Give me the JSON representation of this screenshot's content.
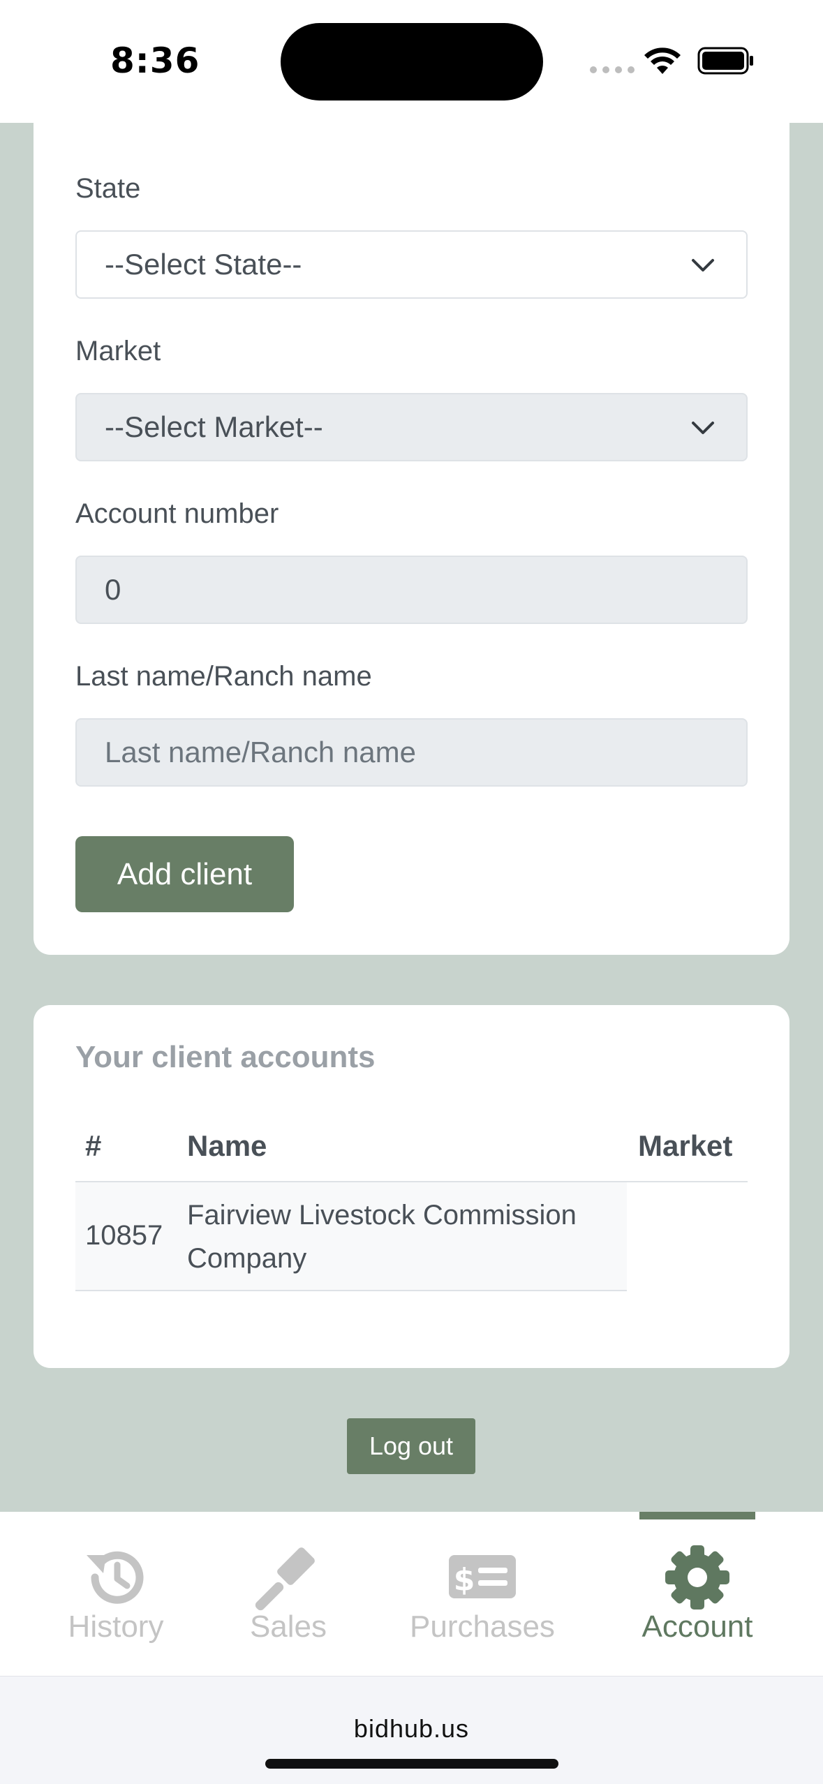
{
  "status_bar": {
    "time": "8:36"
  },
  "form": {
    "state_label": "State",
    "state_value": "--Select State--",
    "market_label": "Market",
    "market_value": "--Select Market--",
    "account_label": "Account number",
    "account_value": "0",
    "lastname_label": "Last name/Ranch name",
    "lastname_placeholder": "Last name/Ranch name",
    "add_button": "Add client"
  },
  "clients": {
    "title": "Your client accounts",
    "columns": {
      "num": "#",
      "name": "Name",
      "market": "Market"
    },
    "rows": [
      {
        "num": "10857",
        "name": "Fairview Livestock Commission Company",
        "market": ""
      }
    ]
  },
  "logout_label": "Log out",
  "tabs": [
    {
      "label": "History",
      "icon": "history-icon",
      "active": false
    },
    {
      "label": "Sales",
      "icon": "gavel-icon",
      "active": false
    },
    {
      "label": "Purchases",
      "icon": "dollar-bill-icon",
      "active": false
    },
    {
      "label": "Account",
      "icon": "gear-icon",
      "active": true
    }
  ],
  "browser": {
    "url": "bidhub.us"
  },
  "colors": {
    "brand_green": "#687e66",
    "page_background": "#c8d3cd",
    "inactive_tab": "#c4c4c4"
  }
}
